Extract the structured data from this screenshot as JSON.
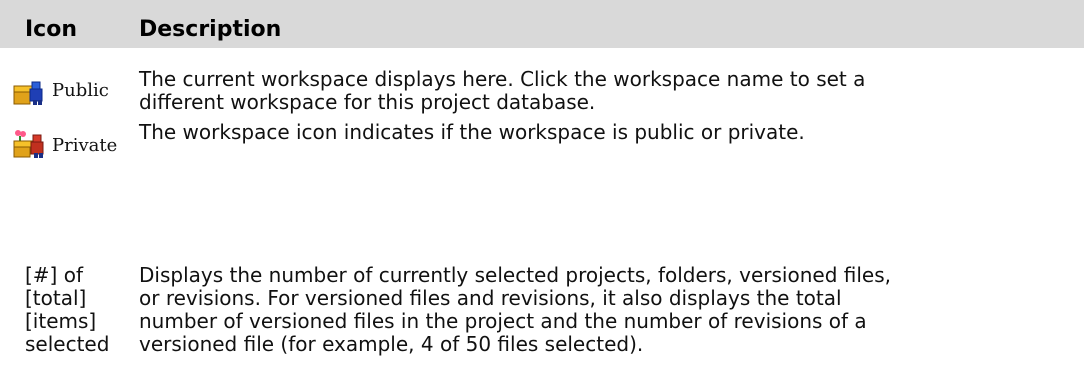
{
  "header": {
    "col1": "Icon",
    "col2": "Description"
  },
  "rows": [
    {
      "icon_label": "Public",
      "icon_name": "public-workspace-icon",
      "description": [
        "The current workspace displays here. Click the workspace name to set a",
        "different workspace for this project database."
      ]
    },
    {
      "icon_label": "Private",
      "icon_name": "private-workspace-icon",
      "description": [
        "The workspace icon indicates if the workspace is public or private."
      ]
    },
    {
      "icon_lines": [
        "[#] of",
        "[total]",
        "[items]",
        "selected"
      ],
      "description": [
        "Displays the number of currently selected projects, folders, versioned files,",
        "or revisions. For versioned files and revisions, it also displays the total",
        "number of versioned files in the project and the number of revisions of a",
        "versioned file (for example, 4 of 50 files selected)."
      ]
    }
  ]
}
